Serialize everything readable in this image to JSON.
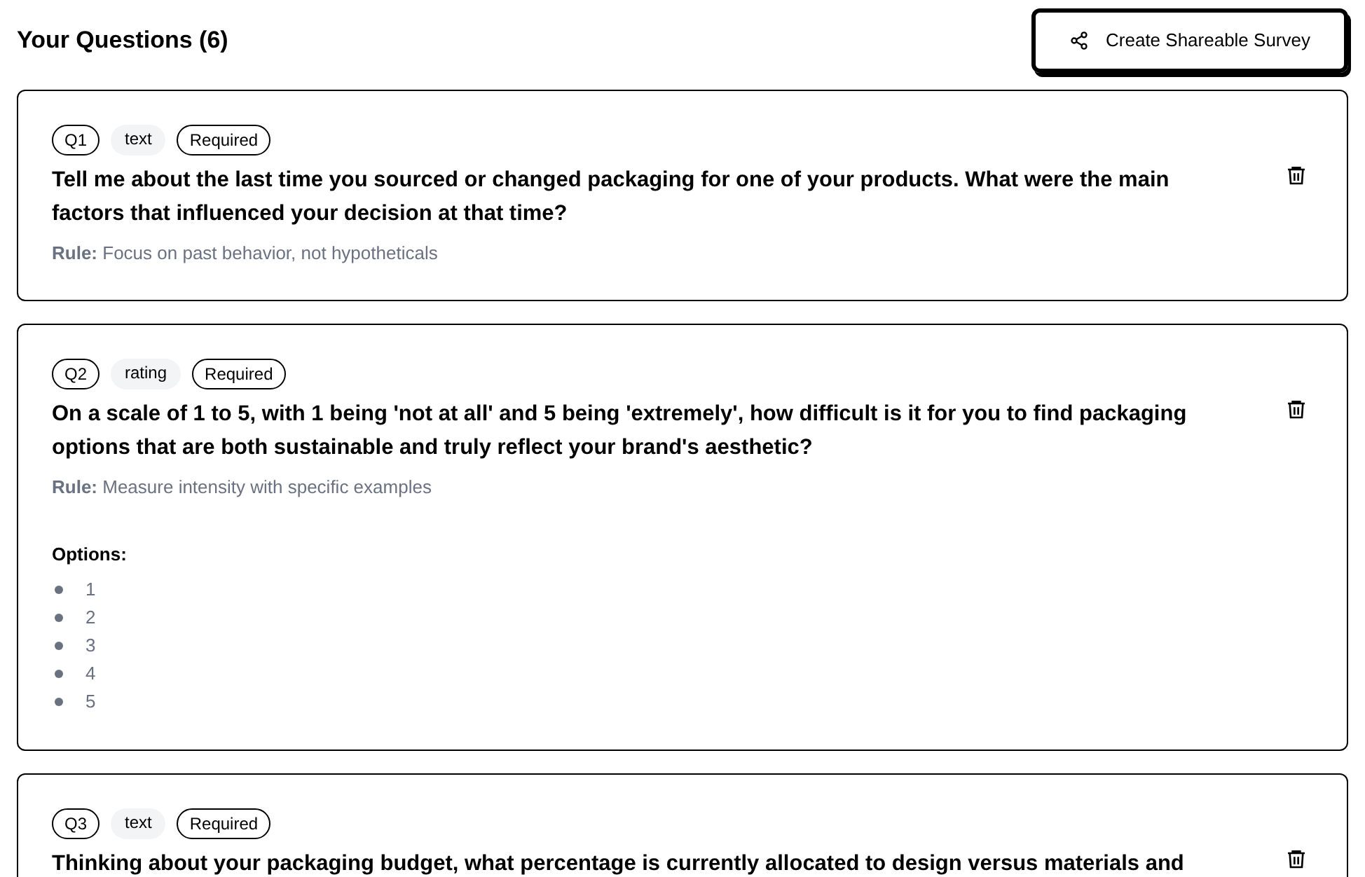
{
  "header": {
    "title": "Your Questions (6)",
    "share_button": "Create Shareable Survey"
  },
  "questions": [
    {
      "number": "Q1",
      "type": "text",
      "required_label": "Required",
      "question": "Tell me about the last time you sourced or changed packaging for one of your products. What were the main factors that influenced your decision at that time?",
      "rule_label": "Rule:",
      "rule": "Focus on past behavior, not hypotheticals"
    },
    {
      "number": "Q2",
      "type": "rating",
      "required_label": "Required",
      "question": "On a scale of 1 to 5, with 1 being 'not at all' and 5 being 'extremely', how difficult is it for you to find packaging options that are both sustainable and truly reflect your brand's aesthetic?",
      "rule_label": "Rule:",
      "rule": "Measure intensity with specific examples",
      "options_label": "Options:",
      "options": [
        "1",
        "2",
        "3",
        "4",
        "5"
      ]
    },
    {
      "number": "Q3",
      "type": "text",
      "required_label": "Required",
      "question": "Thinking about your packaging budget, what percentage is currently allocated to design versus materials and"
    }
  ]
}
